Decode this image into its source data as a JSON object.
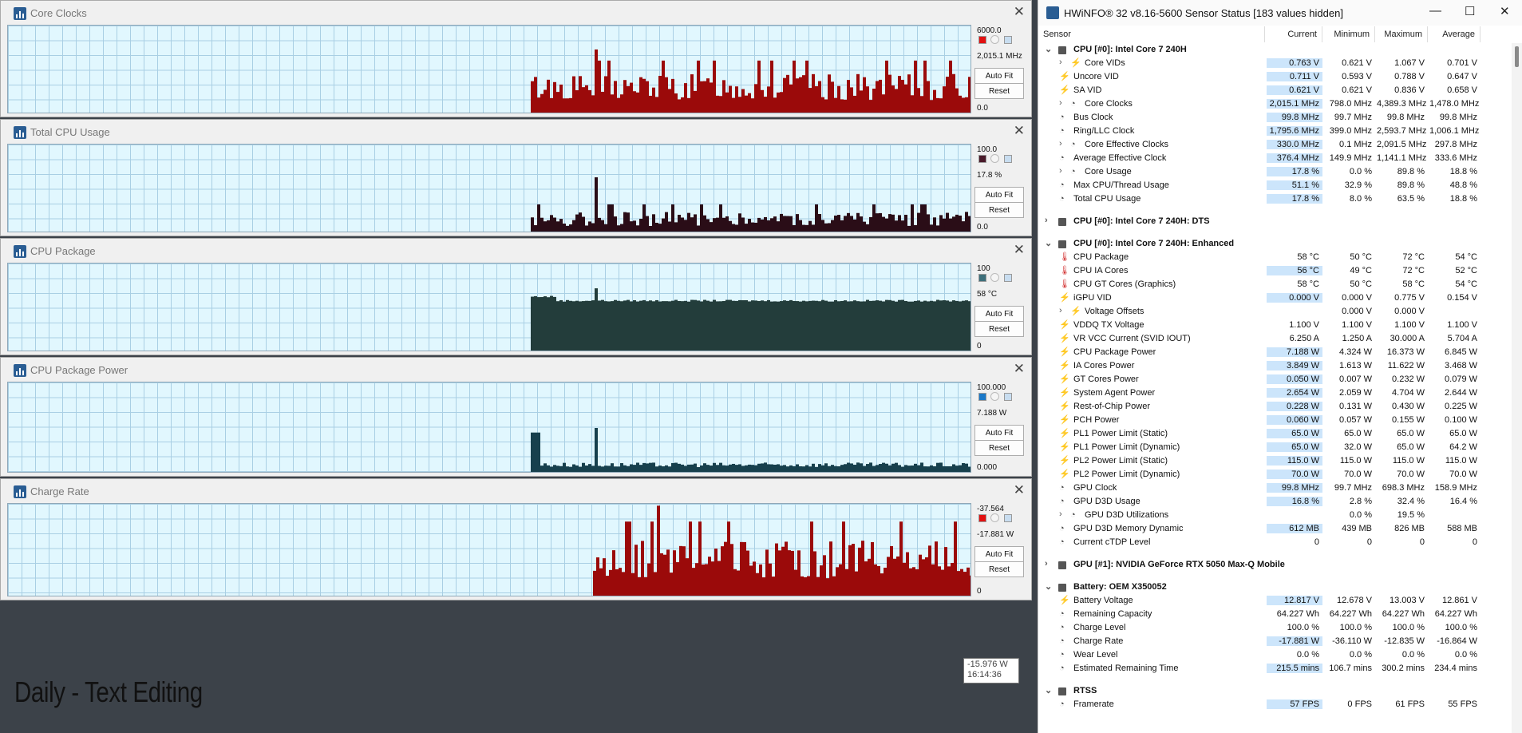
{
  "graphs": [
    {
      "title": "Core Clocks",
      "max": "6000.0",
      "current": "2,015.1 MHz",
      "min": "0.0",
      "color": "#9b0a0a",
      "marker": "#e21010",
      "level": 0.336,
      "spike": 0.73
    },
    {
      "title": "Total CPU Usage",
      "max": "100.0",
      "current": "17.8 %",
      "min": "0.0",
      "color": "#2a0d17",
      "marker": "#4a1a2a",
      "level": 0.18,
      "spike": 0.63
    },
    {
      "title": "CPU Package",
      "max": "100",
      "current": "58 °C",
      "min": "0",
      "color": "#233d3b",
      "marker": "#3d6f7a",
      "level": 0.58,
      "spike": 0.72
    },
    {
      "title": "CPU Package Power",
      "max": "100.000",
      "current": "7.188 W",
      "min": "0.000",
      "color": "#17404d",
      "marker": "#1a78c8",
      "level": 0.07,
      "spike": 0.5
    },
    {
      "title": "Charge Rate",
      "max": "-37.564",
      "current": "-17.881 W",
      "min": "0",
      "color": "#9b0a0a",
      "marker": "#e21010",
      "level": 0.45,
      "spike": 0.98
    }
  ],
  "buttons": {
    "autofit": "Auto Fit",
    "reset": "Reset"
  },
  "overlay_text": "Daily - Text Editing",
  "tooltip": {
    "value": "-15.976 W",
    "time": "16:14:36"
  },
  "sensor_window": {
    "title": "HWiNFO® 32 v8.16-5600 Sensor Status [183 values hidden]",
    "controls": {
      "minimize": "—",
      "maximize": "☐",
      "close": "✕"
    },
    "columns": [
      "Sensor",
      "Current",
      "Minimum",
      "Maximum",
      "Average"
    ]
  },
  "sensor_rows": [
    {
      "type": "group",
      "name": "CPU [#0]: Intel Core 7 240H",
      "open": true
    },
    {
      "name": "Core VIDs",
      "icon": "volt",
      "exp": true,
      "cur": "0.763 V",
      "min": "0.621 V",
      "max": "1.067 V",
      "avg": "0.701 V",
      "hl": true
    },
    {
      "name": "Uncore VID",
      "icon": "volt",
      "cur": "0.711 V",
      "min": "0.593 V",
      "max": "0.788 V",
      "avg": "0.647 V",
      "hl": true
    },
    {
      "name": "SA VID",
      "icon": "volt",
      "cur": "0.621 V",
      "min": "0.621 V",
      "max": "0.836 V",
      "avg": "0.658 V",
      "hl": true
    },
    {
      "name": "Core Clocks",
      "icon": "clk",
      "exp": true,
      "cur": "2,015.1 MHz",
      "min": "798.0 MHz",
      "max": "4,389.3 MHz",
      "avg": "1,478.0 MHz",
      "hl": true
    },
    {
      "name": "Bus Clock",
      "icon": "clk",
      "cur": "99.8 MHz",
      "min": "99.7 MHz",
      "max": "99.8 MHz",
      "avg": "99.8 MHz",
      "hl": true
    },
    {
      "name": "Ring/LLC Clock",
      "icon": "clk",
      "cur": "1,795.6 MHz",
      "min": "399.0 MHz",
      "max": "2,593.7 MHz",
      "avg": "1,006.1 MHz",
      "hl": true
    },
    {
      "name": "Core Effective Clocks",
      "icon": "clk",
      "exp": true,
      "cur": "330.0 MHz",
      "min": "0.1 MHz",
      "max": "2,091.5 MHz",
      "avg": "297.8 MHz",
      "hl": true
    },
    {
      "name": "Average Effective Clock",
      "icon": "clk",
      "cur": "376.4 MHz",
      "min": "149.9 MHz",
      "max": "1,141.1 MHz",
      "avg": "333.6 MHz",
      "hl": true
    },
    {
      "name": "Core Usage",
      "icon": "clk",
      "exp": true,
      "cur": "17.8 %",
      "min": "0.0 %",
      "max": "89.8 %",
      "avg": "18.8 %",
      "hl": true
    },
    {
      "name": "Max CPU/Thread Usage",
      "icon": "clk",
      "cur": "51.1 %",
      "min": "32.9 %",
      "max": "89.8 %",
      "avg": "48.8 %",
      "hl": true
    },
    {
      "name": "Total CPU Usage",
      "icon": "clk",
      "cur": "17.8 %",
      "min": "8.0 %",
      "max": "63.5 %",
      "avg": "18.8 %",
      "hl": true
    },
    {
      "type": "gap"
    },
    {
      "type": "group",
      "name": "CPU [#0]: Intel Core 7 240H: DTS",
      "open": false
    },
    {
      "type": "gap"
    },
    {
      "type": "group",
      "name": "CPU [#0]: Intel Core 7 240H: Enhanced",
      "open": true
    },
    {
      "name": "CPU Package",
      "icon": "temp",
      "cur": "58 °C",
      "min": "50 °C",
      "max": "72 °C",
      "avg": "54 °C"
    },
    {
      "name": "CPU IA Cores",
      "icon": "temp",
      "cur": "56 °C",
      "min": "49 °C",
      "max": "72 °C",
      "avg": "52 °C",
      "hl": true
    },
    {
      "name": "CPU GT Cores (Graphics)",
      "icon": "temp",
      "cur": "58 °C",
      "min": "50 °C",
      "max": "58 °C",
      "avg": "54 °C"
    },
    {
      "name": "iGPU VID",
      "icon": "volt",
      "cur": "0.000 V",
      "min": "0.000 V",
      "max": "0.775 V",
      "avg": "0.154 V",
      "hl": true
    },
    {
      "name": "Voltage Offsets",
      "icon": "volt",
      "exp": true,
      "cur": "",
      "min": "0.000 V",
      "max": "0.000 V",
      "avg": ""
    },
    {
      "name": "VDDQ TX Voltage",
      "icon": "volt",
      "cur": "1.100 V",
      "min": "1.100 V",
      "max": "1.100 V",
      "avg": "1.100 V"
    },
    {
      "name": "VR VCC Current (SVID IOUT)",
      "icon": "volt",
      "cur": "6.250 A",
      "min": "1.250 A",
      "max": "30.000 A",
      "avg": "5.704 A"
    },
    {
      "name": "CPU Package Power",
      "icon": "volt",
      "cur": "7.188 W",
      "min": "4.324 W",
      "max": "16.373 W",
      "avg": "6.845 W",
      "hl": true
    },
    {
      "name": "IA Cores Power",
      "icon": "volt",
      "cur": "3.849 W",
      "min": "1.613 W",
      "max": "11.622 W",
      "avg": "3.468 W",
      "hl": true
    },
    {
      "name": "GT Cores Power",
      "icon": "volt",
      "cur": "0.050 W",
      "min": "0.007 W",
      "max": "0.232 W",
      "avg": "0.079 W",
      "hl": true
    },
    {
      "name": "System Agent Power",
      "icon": "volt",
      "cur": "2.654 W",
      "min": "2.059 W",
      "max": "4.704 W",
      "avg": "2.644 W",
      "hl": true
    },
    {
      "name": "Rest-of-Chip Power",
      "icon": "volt",
      "cur": "0.228 W",
      "min": "0.131 W",
      "max": "0.430 W",
      "avg": "0.225 W",
      "hl": true
    },
    {
      "name": "PCH Power",
      "icon": "volt",
      "cur": "0.060 W",
      "min": "0.057 W",
      "max": "0.155 W",
      "avg": "0.100 W",
      "hl": true
    },
    {
      "name": "PL1 Power Limit (Static)",
      "icon": "volt",
      "cur": "65.0 W",
      "min": "65.0 W",
      "max": "65.0 W",
      "avg": "65.0 W",
      "hl": true
    },
    {
      "name": "PL1 Power Limit (Dynamic)",
      "icon": "volt",
      "cur": "65.0 W",
      "min": "32.0 W",
      "max": "65.0 W",
      "avg": "64.2 W",
      "hl": true
    },
    {
      "name": "PL2 Power Limit (Static)",
      "icon": "volt",
      "cur": "115.0 W",
      "min": "115.0 W",
      "max": "115.0 W",
      "avg": "115.0 W",
      "hl": true
    },
    {
      "name": "PL2 Power Limit (Dynamic)",
      "icon": "volt",
      "cur": "70.0 W",
      "min": "70.0 W",
      "max": "70.0 W",
      "avg": "70.0 W",
      "hl": true
    },
    {
      "name": "GPU Clock",
      "icon": "clk",
      "cur": "99.8 MHz",
      "min": "99.7 MHz",
      "max": "698.3 MHz",
      "avg": "158.9 MHz",
      "hl": true
    },
    {
      "name": "GPU D3D Usage",
      "icon": "clk",
      "cur": "16.8 %",
      "min": "2.8 %",
      "max": "32.4 %",
      "avg": "16.4 %",
      "hl": true
    },
    {
      "name": "GPU D3D Utilizations",
      "icon": "clk",
      "exp": true,
      "cur": "",
      "min": "0.0 %",
      "max": "19.5 %",
      "avg": ""
    },
    {
      "name": "GPU D3D Memory Dynamic",
      "icon": "clk",
      "cur": "612 MB",
      "min": "439 MB",
      "max": "826 MB",
      "avg": "588 MB",
      "hl": true
    },
    {
      "name": "Current cTDP Level",
      "icon": "clk",
      "cur": "0",
      "min": "0",
      "max": "0",
      "avg": "0"
    },
    {
      "type": "gap"
    },
    {
      "type": "group",
      "name": "GPU [#1]: NVIDIA  GeForce RTX 5050 Max-Q Mobile",
      "open": false
    },
    {
      "type": "gap"
    },
    {
      "type": "group",
      "name": "Battery: OEM X350052",
      "open": true
    },
    {
      "name": "Battery Voltage",
      "icon": "volt",
      "cur": "12.817 V",
      "min": "12.678 V",
      "max": "13.003 V",
      "avg": "12.861 V",
      "hl": true
    },
    {
      "name": "Remaining Capacity",
      "icon": "clk",
      "cur": "64.227 Wh",
      "min": "64.227 Wh",
      "max": "64.227 Wh",
      "avg": "64.227 Wh"
    },
    {
      "name": "Charge Level",
      "icon": "clk",
      "cur": "100.0 %",
      "min": "100.0 %",
      "max": "100.0 %",
      "avg": "100.0 %"
    },
    {
      "name": "Charge Rate",
      "icon": "clk",
      "cur": "-17.881 W",
      "min": "-36.110 W",
      "max": "-12.835 W",
      "avg": "-16.864 W",
      "hl": true
    },
    {
      "name": "Wear Level",
      "icon": "clk",
      "cur": "0.0 %",
      "min": "0.0 %",
      "max": "0.0 %",
      "avg": "0.0 %"
    },
    {
      "name": "Estimated Remaining Time",
      "icon": "clk",
      "cur": "215.5 mins",
      "min": "106.7 mins",
      "max": "300.2 mins",
      "avg": "234.4 mins",
      "hl": true
    },
    {
      "type": "gap"
    },
    {
      "type": "group",
      "name": "RTSS",
      "open": true
    },
    {
      "name": "Framerate",
      "icon": "clk",
      "cur": "57 FPS",
      "min": "0 FPS",
      "max": "61 FPS",
      "avg": "55 FPS",
      "hl": true
    }
  ]
}
